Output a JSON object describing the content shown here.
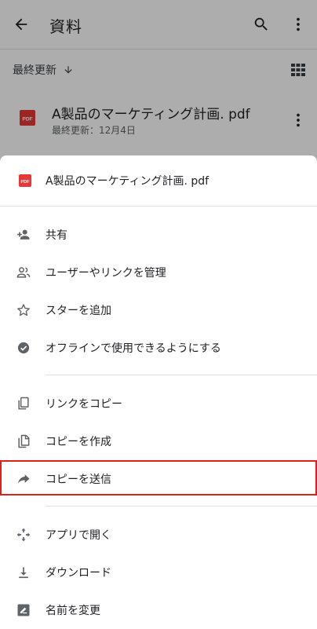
{
  "app_bar": {
    "title": "資料",
    "back_icon": "arrow-back-icon",
    "search_icon": "search-icon",
    "more_icon": "more-vert-icon"
  },
  "sort": {
    "label": "最終更新",
    "arrow_icon": "arrow-down-icon",
    "view_icon": "grid-view-icon"
  },
  "file": {
    "icon_text": "PDF",
    "name": "A製品のマーケティング計画. pdf",
    "modified": "最終更新：12月4日"
  },
  "sheet": {
    "icon_text": "PDF",
    "title": "A製品のマーケティング計画. pdf",
    "items": [
      {
        "label": "共有",
        "icon": "person-add-icon"
      },
      {
        "label": "ユーザーやリンクを管理",
        "icon": "people-icon"
      },
      {
        "label": "スターを追加",
        "icon": "star-outline-icon"
      },
      {
        "label": "オフラインで使用できるようにする",
        "icon": "offline-check-icon"
      },
      {
        "label": "リンクをコピー",
        "icon": "copy-link-icon"
      },
      {
        "label": "コピーを作成",
        "icon": "file-copy-icon"
      },
      {
        "label": "コピーを送信",
        "icon": "send-arrow-icon"
      },
      {
        "label": "アプリで開く",
        "icon": "open-with-icon"
      },
      {
        "label": "ダウンロード",
        "icon": "download-icon"
      },
      {
        "label": "名前を変更",
        "icon": "rename-icon"
      }
    ]
  },
  "colors": {
    "pdf_red": "#e53935",
    "icon_gray": "#5f6368",
    "highlight": "#e0201c"
  }
}
